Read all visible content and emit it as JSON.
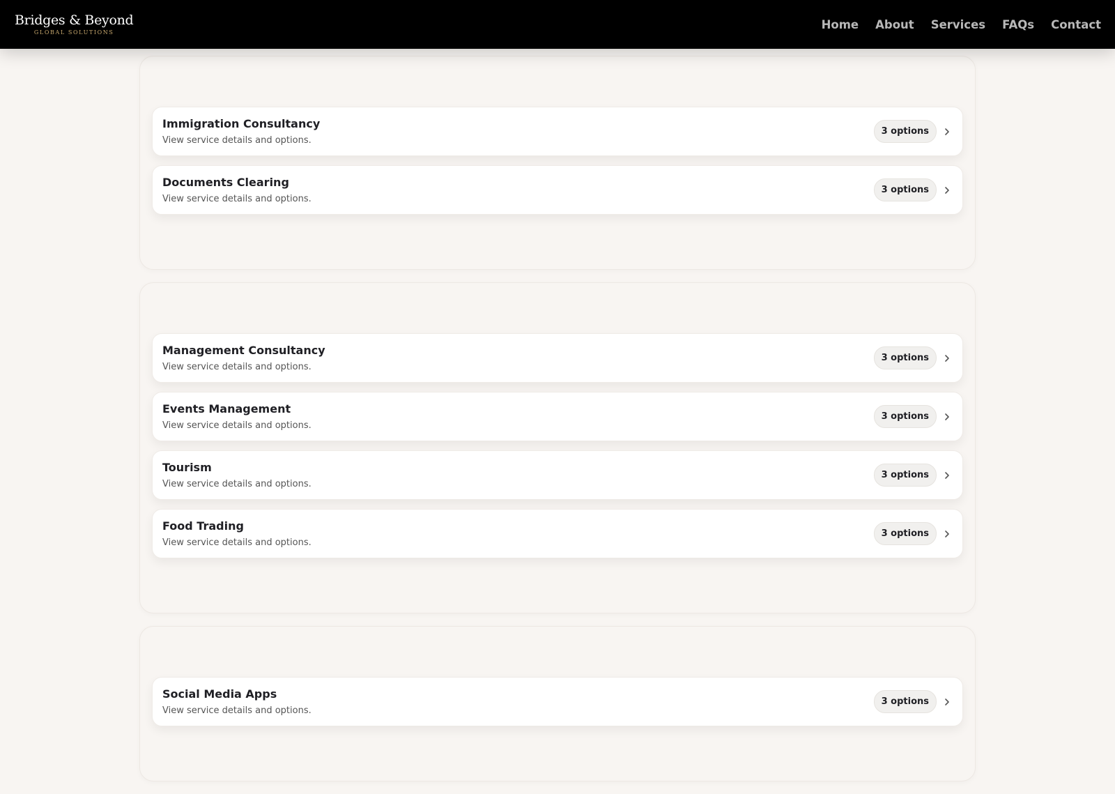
{
  "header": {
    "logo_main": "Bridges & Beyond",
    "logo_sub": "GLOBAL SOLUTIONS",
    "nav": [
      "Home",
      "About",
      "Services",
      "FAQs",
      "Contact"
    ]
  },
  "groups": [
    {
      "services": [
        {
          "title": "Immigration Consultancy",
          "description": "View service details and options.",
          "badge": "3 options"
        },
        {
          "title": "Documents Clearing",
          "description": "View service details and options.",
          "badge": "3 options"
        }
      ]
    },
    {
      "services": [
        {
          "title": "Management Consultancy",
          "description": "View service details and options.",
          "badge": "3 options"
        },
        {
          "title": "Events Management",
          "description": "View service details and options.",
          "badge": "3 options"
        },
        {
          "title": "Tourism",
          "description": "View service details and options.",
          "badge": "3 options"
        },
        {
          "title": "Food Trading",
          "description": "View service details and options.",
          "badge": "3 options"
        }
      ]
    },
    {
      "services": [
        {
          "title": "Social Media Apps",
          "description": "View service details and options.",
          "badge": "3 options"
        }
      ]
    }
  ],
  "colors": {
    "header_bg": "#000000",
    "page_bg": "#f8f5f2",
    "logo_accent": "#c9a96e",
    "nav_text": "#b8b8b8"
  },
  "icons": [
    "chevron-right-icon"
  ]
}
